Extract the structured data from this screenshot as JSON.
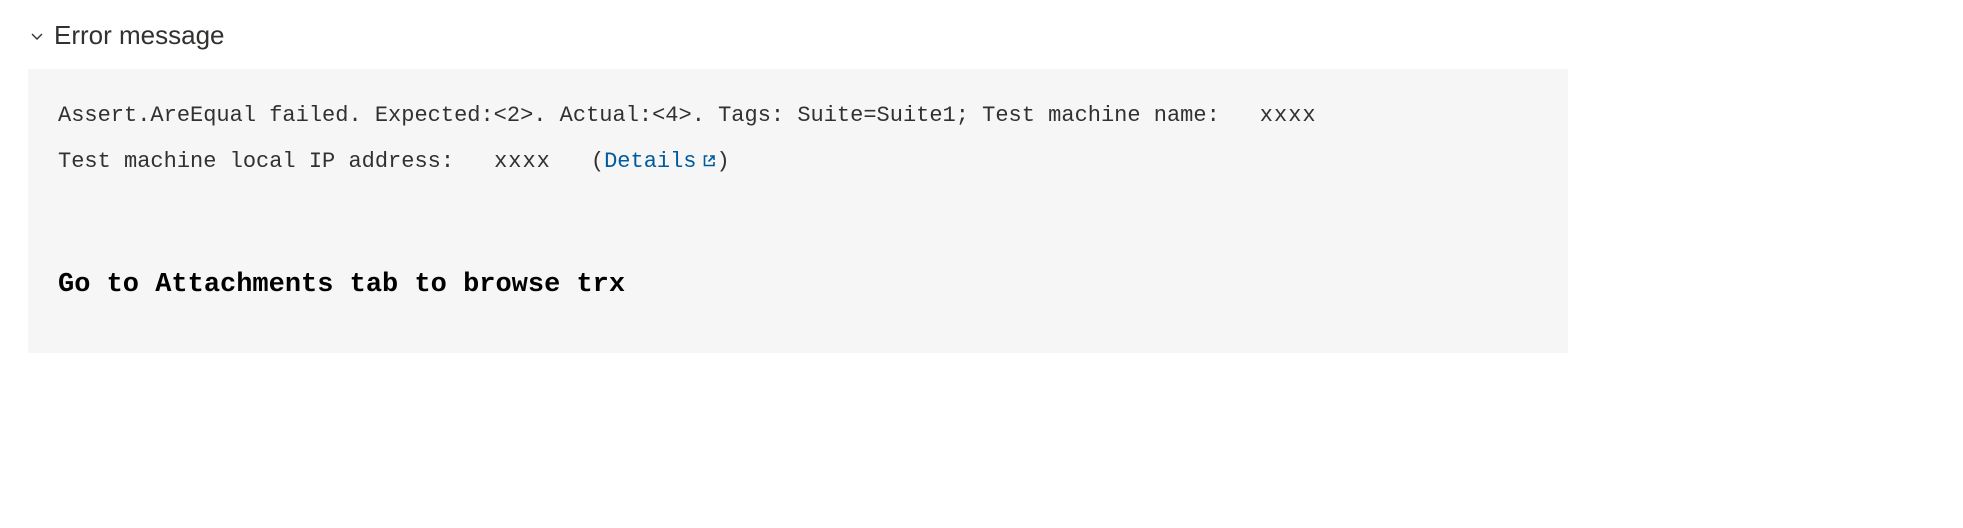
{
  "header": {
    "title": "Error message"
  },
  "message": {
    "segA": "Assert.AreEqual failed. Expected:<2>. Actual:<4>. Tags: Suite=Suite1; Test machine name:",
    "machineName": "xxxx",
    "segB": "Test machine local IP address:",
    "ipAddress": "xxxx",
    "parenOpen": "(",
    "detailsLabel": "Details",
    "parenClose": ")",
    "bold": "Go to Attachments tab to browse trx"
  }
}
